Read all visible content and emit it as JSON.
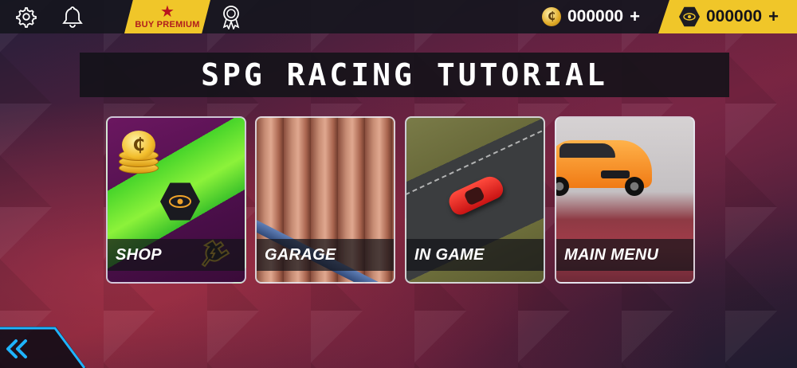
{
  "topbar": {
    "buy_premium_label": "BUY PREMIUM",
    "coins_value": "000000",
    "coins_plus": "+",
    "gems_value": "000000",
    "gems_plus": "+"
  },
  "title": "SPG RACING TUTORIAL",
  "cards": [
    {
      "label": "SHOP"
    },
    {
      "label": "GARAGE"
    },
    {
      "label": "IN GAME"
    },
    {
      "label": "MAIN MENU"
    }
  ],
  "colors": {
    "accent_yellow": "#f0c629",
    "premium_red": "#b01d1d",
    "topbar_bg": "#16161e",
    "back_button_cyan": "#1fb4ff"
  },
  "icons": {
    "settings": "gear-icon",
    "notifications": "bell-icon",
    "premium": "star-icon",
    "achievements": "badge-icon",
    "coin": "coin-icon",
    "gem": "hex-token-icon",
    "back": "double-chevron-left-icon"
  }
}
